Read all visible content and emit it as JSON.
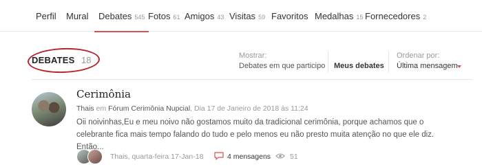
{
  "tabs": [
    {
      "label": "Perfil",
      "count": ""
    },
    {
      "label": "Mural",
      "count": ""
    },
    {
      "label": "Debates",
      "count": "545"
    },
    {
      "label": "Fotos",
      "count": "61"
    },
    {
      "label": "Amigos",
      "count": "43"
    },
    {
      "label": "Visitas",
      "count": "59"
    },
    {
      "label": "Favoritos",
      "count": ""
    },
    {
      "label": "Medalhas",
      "count": "15"
    },
    {
      "label": "Fornecedores",
      "count": "2"
    }
  ],
  "active_tab": "Debates",
  "section": {
    "title": "DEBATES",
    "count": "18"
  },
  "filter": {
    "label": "Mostrar:",
    "option_participating": "Debates em que participo",
    "option_mine": "Meus debates"
  },
  "sort": {
    "label": "Ordenar por:",
    "value": "Última mensagem"
  },
  "post": {
    "title": "Cerimônia",
    "author": "Thais",
    "in_word": "em",
    "forum": "Fórum Cerimônia Nupcial",
    "date": ", Dia 17 de Janeiro de 2018 às 11:24",
    "excerpt": "Oii noivinhas,Eu e meu noivo não gostamos muito da tradicional cerimônia, porque achamos que o celebrante fica mais tempo falando do tudo e pelo menos eu não presto muita atenção no que ele diz. Então...",
    "last_activity": "Thais, quarta-feira 17-Jan-18",
    "messages": "4 mensagens",
    "views": "51"
  },
  "colors": {
    "accent": "#d94f4f",
    "annotation": "#b3262d"
  }
}
